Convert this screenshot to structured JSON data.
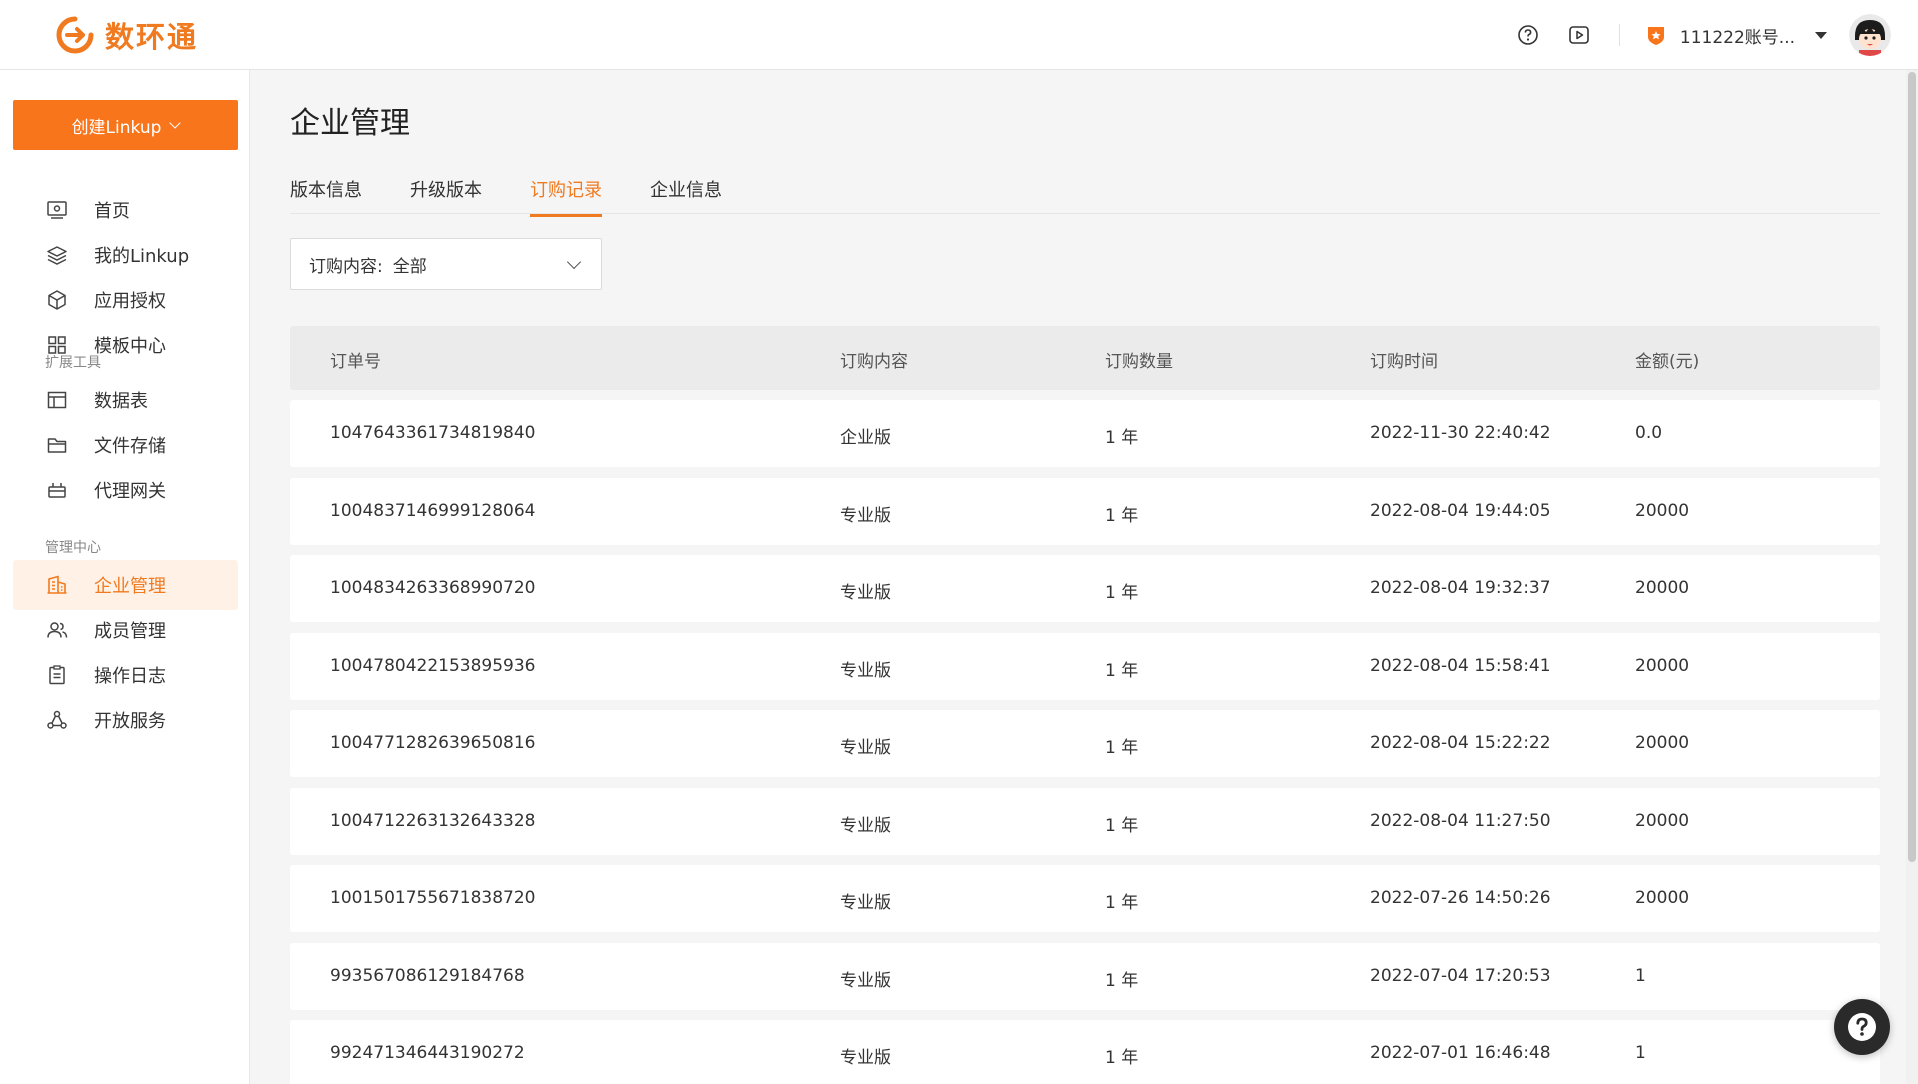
{
  "header": {
    "logo_text": "数环通",
    "account_name": "111222账号...",
    "colors": {
      "brand": "#f07a20",
      "button": "#f8751c"
    }
  },
  "sidebar": {
    "create_button": "创建Linkup",
    "items_main": [
      {
        "label": "首页",
        "icon": "monitor-icon"
      },
      {
        "label": "我的Linkup",
        "icon": "layers-icon"
      },
      {
        "label": "应用授权",
        "icon": "cube-icon"
      },
      {
        "label": "模板中心",
        "icon": "grid-icon"
      }
    ],
    "group_tools": "扩展工具",
    "items_tools": [
      {
        "label": "数据表",
        "icon": "table-icon"
      },
      {
        "label": "文件存储",
        "icon": "folder-icon"
      },
      {
        "label": "代理网关",
        "icon": "gateway-icon"
      }
    ],
    "group_manage": "管理中心",
    "items_manage": [
      {
        "label": "企业管理",
        "icon": "building-icon",
        "active": true
      },
      {
        "label": "成员管理",
        "icon": "users-icon"
      },
      {
        "label": "操作日志",
        "icon": "clipboard-icon"
      },
      {
        "label": "开放服务",
        "icon": "share-icon"
      }
    ]
  },
  "main": {
    "title": "企业管理",
    "tabs": [
      {
        "label": "版本信息"
      },
      {
        "label": "升级版本"
      },
      {
        "label": "订购记录",
        "active": true
      },
      {
        "label": "企业信息"
      }
    ],
    "filter": {
      "label": "订购内容:",
      "value": "全部"
    },
    "table": {
      "columns": [
        "订单号",
        "订购内容",
        "订购数量",
        "订购时间",
        "金额(元)"
      ],
      "rows": [
        [
          "1047643361734819840",
          "企业版",
          "1 年",
          "2022-11-30 22:40:42",
          "0.0"
        ],
        [
          "1004837146999128064",
          "专业版",
          "1 年",
          "2022-08-04 19:44:05",
          "20000"
        ],
        [
          "1004834263368990720",
          "专业版",
          "1 年",
          "2022-08-04 19:32:37",
          "20000"
        ],
        [
          "1004780422153895936",
          "专业版",
          "1 年",
          "2022-08-04 15:58:41",
          "20000"
        ],
        [
          "1004771282639650816",
          "专业版",
          "1 年",
          "2022-08-04 15:22:22",
          "20000"
        ],
        [
          "1004712263132643328",
          "专业版",
          "1 年",
          "2022-08-04 11:27:50",
          "20000"
        ],
        [
          "1001501755671838720",
          "专业版",
          "1 年",
          "2022-07-26 14:50:26",
          "20000"
        ],
        [
          "993567086129184768",
          "专业版",
          "1 年",
          "2022-07-04 17:20:53",
          "1"
        ],
        [
          "992471346443190272",
          "专业版",
          "1 年",
          "2022-07-01 16:46:48",
          "1"
        ]
      ]
    }
  }
}
